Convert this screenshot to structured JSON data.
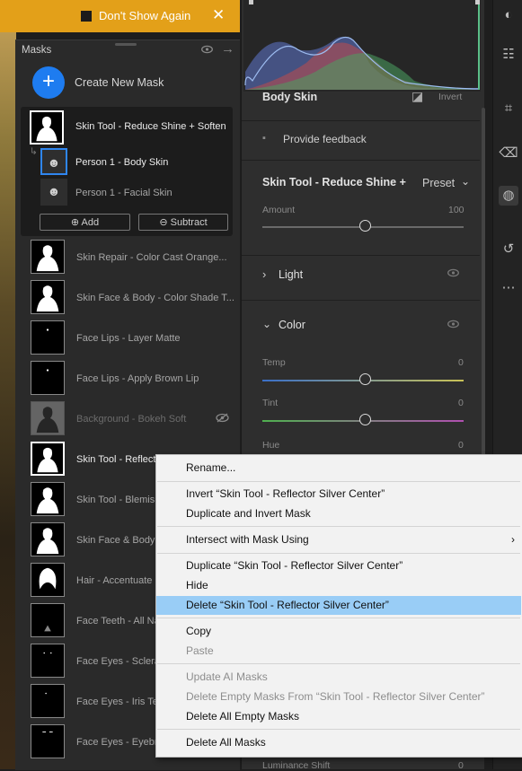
{
  "notification": {
    "checkbox_label": "Don't Show Again",
    "close": "✕"
  },
  "masks_panel": {
    "title": "Masks",
    "create_label": "Create New Mask",
    "group": {
      "main_label": "Skin Tool - Reduce Shine + Soften",
      "subs": [
        "Person 1 - Body Skin",
        "Person 1 - Facial Skin"
      ],
      "add_label": "Add",
      "subtract_label": "Subtract"
    },
    "items": [
      "Skin Repair - Color Cast Orange...",
      "Skin Face & Body - Color Shade T...",
      "Face Lips - Layer Matte",
      "Face Lips - Apply Brown Lip",
      "Background - Bokeh Soft",
      "Skin Tool - Reflector Silver Center",
      "Skin Tool - Blemish",
      "Skin Face & Body",
      "Hair - Accentuate",
      "Face Teeth - All Na",
      "Face Eyes - Sclera",
      "Face Eyes - Iris Tex",
      "Face Eyes - Eyebro"
    ]
  },
  "adjust_panel": {
    "body_skin_label": "Body Skin",
    "invert_label": "Invert",
    "feedback_label": "Provide feedback",
    "preset_title": "Skin Tool - Reduce Shine +",
    "preset_label": "Preset",
    "amount_label": "Amount",
    "amount_value": "100",
    "light_label": "Light",
    "color_label": "Color",
    "temp_label": "Temp",
    "temp_value": "0",
    "tint_label": "Tint",
    "tint_value": "0",
    "hue_label": "Hue",
    "hue_value": "0",
    "luminance_label": "Luminance Shift",
    "luminance_value": "0"
  },
  "context_menu": {
    "items": [
      {
        "label": "Rename...",
        "disabled": false
      },
      {
        "label": "Invert “Skin Tool - Reflector Silver Center”",
        "disabled": false
      },
      {
        "label": "Duplicate and Invert Mask",
        "disabled": false
      },
      {
        "label": "Intersect with Mask Using",
        "disabled": false,
        "submenu": "›"
      },
      {
        "label": "Duplicate “Skin Tool - Reflector Silver Center”",
        "disabled": false
      },
      {
        "label": "Hide",
        "disabled": false
      },
      {
        "label": "Delete “Skin Tool - Reflector Silver Center”",
        "disabled": false,
        "highlighted": true
      },
      {
        "label": "Copy",
        "disabled": false
      },
      {
        "label": "Paste",
        "disabled": true
      },
      {
        "label": "Update AI Masks",
        "disabled": true
      },
      {
        "label": "Delete Empty Masks From “Skin Tool - Reflector Silver Center”",
        "disabled": true
      },
      {
        "label": "Delete All Empty Masks",
        "disabled": false
      },
      {
        "label": "Delete All Masks",
        "disabled": false
      }
    ]
  },
  "colors": {
    "accent": "#1e7cf0",
    "notification": "#e3a019",
    "menu_highlight": "#99cdf6"
  },
  "toolbar_icons": [
    "edit-icon",
    "sliders-icon",
    "crop-icon",
    "eraser-icon",
    "masking-icon",
    "history-icon",
    "more-icon"
  ]
}
